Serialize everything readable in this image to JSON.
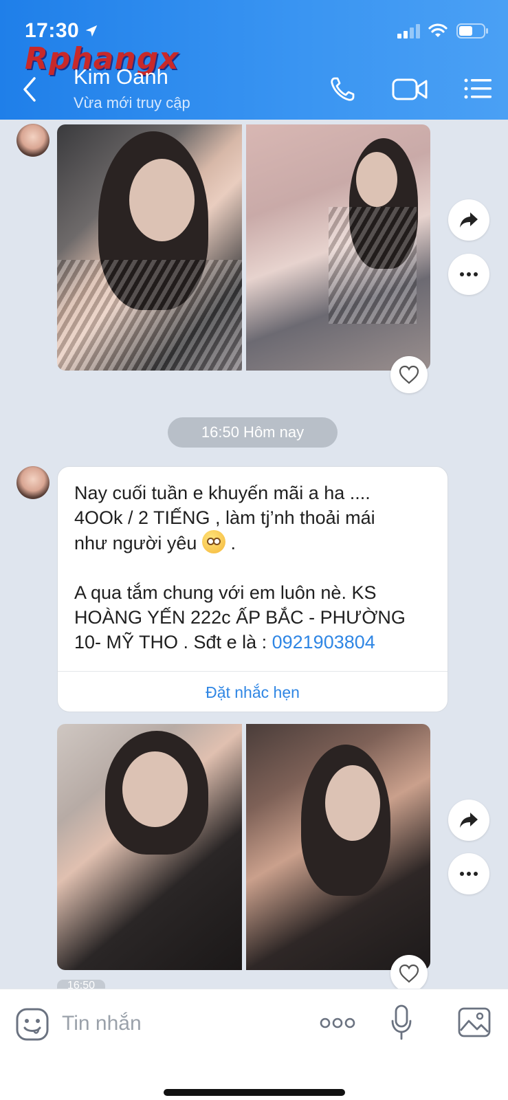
{
  "status_bar": {
    "time": "17:30"
  },
  "watermark": "Rphangx",
  "header": {
    "contact_name": "Kim Oanh",
    "contact_status": "Vừa mới truy cập"
  },
  "chat": {
    "time_divider": "16:50 Hôm nay",
    "message": {
      "text": "Nay cuối tuần e khuyến mãi a ha ....\n4OOk / 2 TIẾNG , làm tj’nh thoải mái\nnhư người yêu",
      "text_after_emoji": " .",
      "text2": "\n\nA qua tắm chung với em luôn nè. KS\nHOÀNG YẾN 222c ẤP BẮC - PHƯỜNG\n10- MỸ THO . Sđt e là : ",
      "phone": "0921903804",
      "reminder_label": "Đặt nhắc hẹn"
    },
    "bottom_timestamp": "16:50"
  },
  "composer": {
    "placeholder": "Tin nhắn"
  },
  "colors": {
    "header_blue": "#2f86e4",
    "link_blue": "#2f86e4"
  }
}
